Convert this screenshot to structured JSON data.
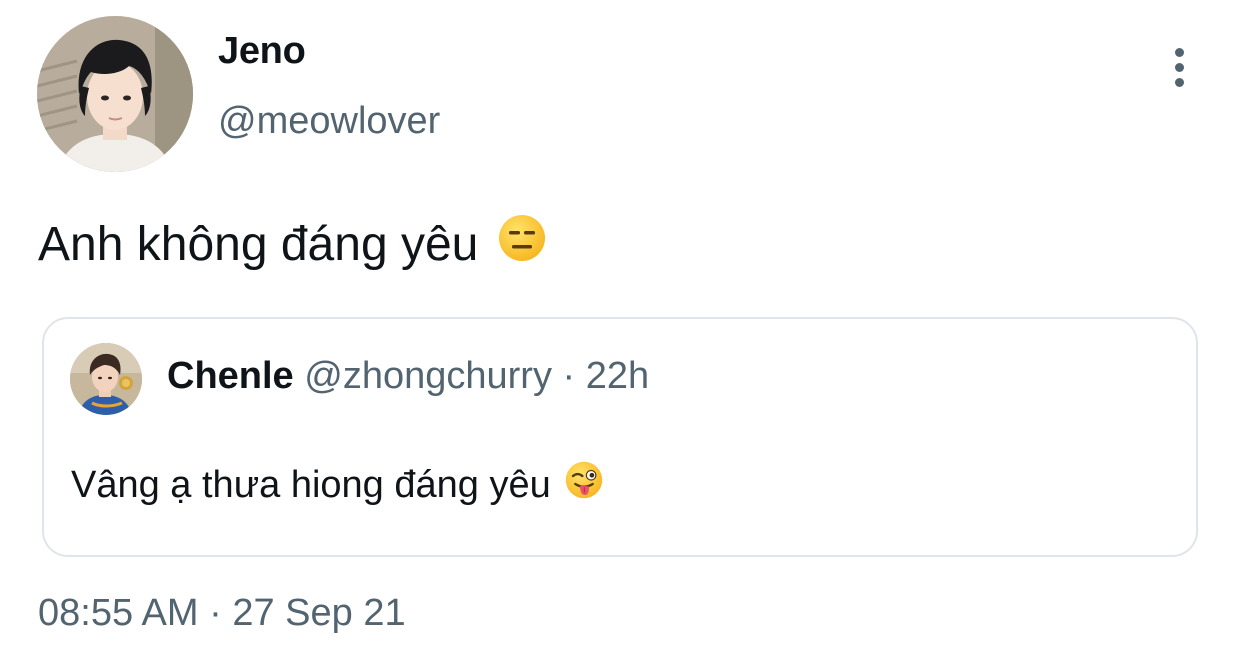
{
  "tweet": {
    "author": {
      "display_name": "Jeno",
      "handle": "@meowlover"
    },
    "text": "Anh không đáng yêu",
    "text_emoji": "expressionless-face",
    "quote": {
      "author": {
        "display_name": "Chenle",
        "handle": "@zhongchurry"
      },
      "separator": "·",
      "age": "22h",
      "text": "Vâng ạ thưa hiong đáng yêu",
      "text_emoji": "winking-face-with-tongue"
    },
    "timestamp": {
      "time": "08:55 AM",
      "separator": "·",
      "date": "27 Sep 21"
    }
  },
  "colors": {
    "primary_text": "#0f1419",
    "secondary_text": "#536471",
    "card_border": "#dfe5ea",
    "background": "#ffffff"
  },
  "icons": {
    "more": "more-vertical-icon"
  }
}
